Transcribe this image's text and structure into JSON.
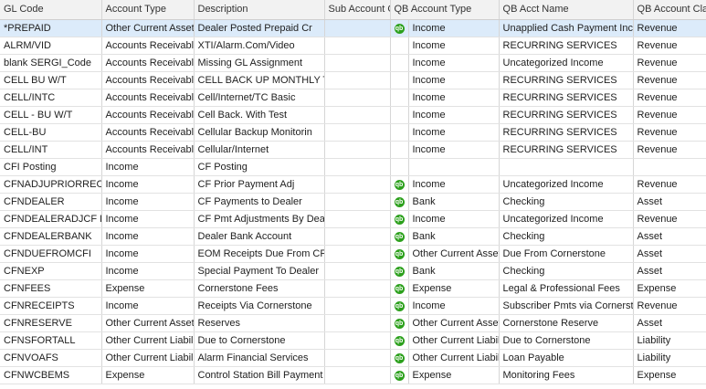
{
  "columns": [
    "GL Code",
    "Account Type",
    "Description",
    "Sub Account Of",
    "QB Account Type",
    "QB Acct Name",
    "QB Account Class"
  ],
  "icon": {
    "name": "quickbooks-icon",
    "glyph": "qb",
    "color": "#2ca01c"
  },
  "rows": [
    {
      "code": "*PREPAID",
      "type": "Other Current Asset",
      "desc": "Dealer Posted Prepaid Cr",
      "sub": "",
      "qb": true,
      "qbtype": "Income",
      "qbname": "Unapplied Cash Payment Income",
      "qbclass": "Revenue",
      "selected": true
    },
    {
      "code": "ALRM/VID",
      "type": "Accounts Receivable",
      "desc": "XTI/Alarm.Com/Video",
      "sub": "",
      "qb": false,
      "qbtype": "Income",
      "qbname": "RECURRING SERVICES",
      "qbclass": "Revenue"
    },
    {
      "code": "blank SERGI_Code",
      "type": "Accounts Receivable",
      "desc": "Missing GL Assignment",
      "sub": "",
      "qb": false,
      "qbtype": "Income",
      "qbname": "Uncategorized Income",
      "qbclass": "Revenue"
    },
    {
      "code": "CELL BU W/T",
      "type": "Accounts Receivable",
      "desc": "CELL BACK UP MONTHLY TEST",
      "sub": "",
      "qb": false,
      "qbtype": "Income",
      "qbname": "RECURRING SERVICES",
      "qbclass": "Revenue"
    },
    {
      "code": "CELL/INTC",
      "type": "Accounts Receivable",
      "desc": "Cell/Internet/TC Basic",
      "sub": "",
      "qb": false,
      "qbtype": "Income",
      "qbname": "RECURRING SERVICES",
      "qbclass": "Revenue"
    },
    {
      "code": "CELL - BU W/T",
      "type": "Accounts Receivable",
      "desc": "Cell Back. With Test",
      "sub": "",
      "qb": false,
      "qbtype": "Income",
      "qbname": "RECURRING SERVICES",
      "qbclass": "Revenue"
    },
    {
      "code": "CELL-BU",
      "type": "Accounts Receivable",
      "desc": "Cellular Backup Monitorin",
      "sub": "",
      "qb": false,
      "qbtype": "Income",
      "qbname": "RECURRING SERVICES",
      "qbclass": "Revenue"
    },
    {
      "code": "CELL/INT",
      "type": "Accounts Receivable",
      "desc": "Cellular/Internet",
      "sub": "",
      "qb": false,
      "qbtype": "Income",
      "qbname": "RECURRING SERVICES",
      "qbclass": "Revenue"
    },
    {
      "code": "CFI Posting",
      "type": "Income",
      "desc": "CF Posting",
      "sub": "",
      "qb": false,
      "qbtype": "",
      "qbname": "",
      "qbclass": ""
    },
    {
      "code": "CFNADJUPRIORRECEIPT",
      "type": "Income",
      "desc": "CF Prior Payment Adj",
      "sub": "",
      "qb": true,
      "qbtype": "Income",
      "qbname": "Uncategorized Income",
      "qbclass": "Revenue"
    },
    {
      "code": "CFNDEALER",
      "type": "Income",
      "desc": "CF Payments to Dealer",
      "sub": "",
      "qb": true,
      "qbtype": "Bank",
      "qbname": "Checking",
      "qbclass": "Asset"
    },
    {
      "code": "CFNDEALERADJCF PMT",
      "type": "Income",
      "desc": "CF Pmt Adjustments By Dealer",
      "sub": "",
      "qb": true,
      "qbtype": "Income",
      "qbname": "Uncategorized Income",
      "qbclass": "Revenue"
    },
    {
      "code": "CFNDEALERBANK",
      "type": "Income",
      "desc": "Dealer Bank Account",
      "sub": "",
      "qb": true,
      "qbtype": "Bank",
      "qbname": "Checking",
      "qbclass": "Asset"
    },
    {
      "code": "CFNDUEFROMCFI",
      "type": "Income",
      "desc": "EOM Receipts Due From CFI",
      "sub": "",
      "qb": true,
      "qbtype": "Other Current Asset",
      "qbname": "Due From Cornerstone",
      "qbclass": "Asset"
    },
    {
      "code": "CFNEXP",
      "type": "Income",
      "desc": "Special Payment To Dealer",
      "sub": "",
      "qb": true,
      "qbtype": "Bank",
      "qbname": "Checking",
      "qbclass": "Asset"
    },
    {
      "code": "CFNFEES",
      "type": "Expense",
      "desc": "Cornerstone Fees",
      "sub": "",
      "qb": true,
      "qbtype": "Expense",
      "qbname": "Legal & Professional Fees",
      "qbclass": "Expense"
    },
    {
      "code": "CFNRECEIPTS",
      "type": "Income",
      "desc": "Receipts Via Cornerstone",
      "sub": "",
      "qb": true,
      "qbtype": "Income",
      "qbname": "Subscriber Pmts via Cornerstone",
      "qbclass": "Revenue"
    },
    {
      "code": "CFNRESERVE",
      "type": "Other Current Asset",
      "desc": "Reserves",
      "sub": "",
      "qb": true,
      "qbtype": "Other Current Asset",
      "qbname": "Cornerstone Reserve",
      "qbclass": "Asset"
    },
    {
      "code": "CFNSFORTALL",
      "type": "Other Current Liability",
      "desc": "Due to Cornerstone",
      "sub": "",
      "qb": true,
      "qbtype": "Other Current Liability",
      "qbname": "Due to Cornerstone",
      "qbclass": "Liability"
    },
    {
      "code": "CFNVOAFS",
      "type": "Other Current Liability",
      "desc": "Alarm Financial Services",
      "sub": "",
      "qb": true,
      "qbtype": "Other Current Liability",
      "qbname": "Loan Payable",
      "qbclass": "Liability"
    },
    {
      "code": "CFNWCBEMS",
      "type": "Expense",
      "desc": "Control Station Bill Payment",
      "sub": "",
      "qb": true,
      "qbtype": "Expense",
      "qbname": "Monitoring Fees",
      "qbclass": "Expense"
    }
  ]
}
